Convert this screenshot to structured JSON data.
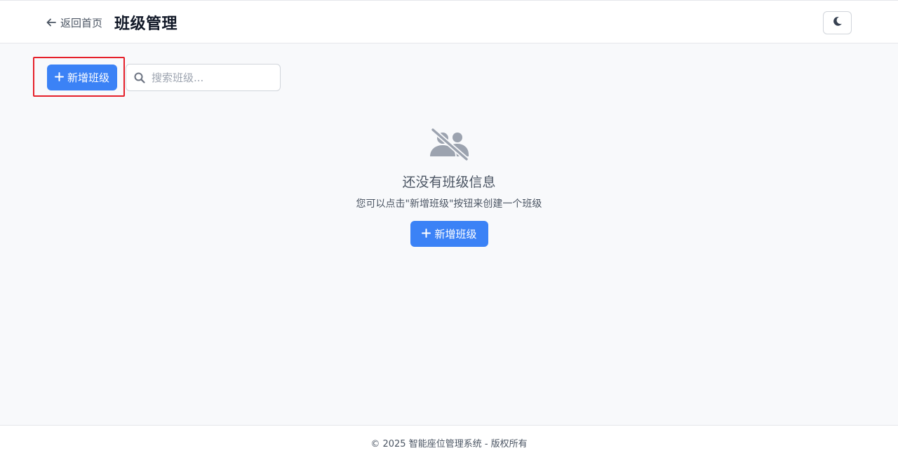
{
  "header": {
    "back_label": "返回首页",
    "title": "班级管理",
    "theme_toggle_icon": "moon-icon"
  },
  "toolbar": {
    "add_label": "新增班级",
    "search_placeholder": "搜索班级...",
    "search_value": ""
  },
  "empty_state": {
    "icon": "users-slash-icon",
    "title": "还没有班级信息",
    "description": "您可以点击\"新增班级\"按钮来创建一个班级",
    "add_label": "新增班级"
  },
  "footer": {
    "copyright": "© 2025 智能座位管理系统 - 版权所有"
  },
  "colors": {
    "primary": "#3b82f6",
    "highlight": "#e5202a",
    "muted_icon": "#9ca3af"
  }
}
